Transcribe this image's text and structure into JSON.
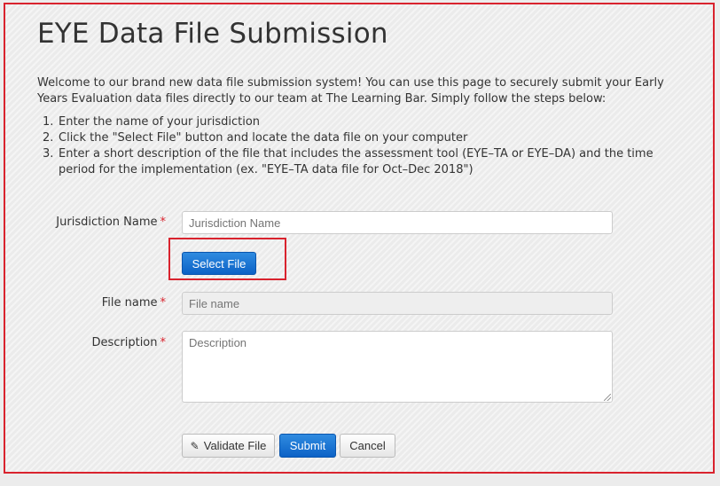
{
  "page": {
    "title": "EYE Data File Submission",
    "intro": "Welcome to our brand new data file submission system! You can use this page to securely submit your Early Years Evaluation data files directly to our team at The Learning Bar. Simply follow the steps below:",
    "steps": [
      {
        "num": "1.",
        "text": "Enter the name of your jurisdiction"
      },
      {
        "num": "2.",
        "text": "Click the \"Select File\" button and locate the data file on your computer"
      },
      {
        "num": "3.",
        "text": "Enter a short description of the file that includes the assessment tool (EYE–TA or EYE–DA) and the time period for the implementation (ex. \"EYE–TA data file for Oct–Dec 2018\")"
      }
    ]
  },
  "form": {
    "required_marker": "*",
    "jurisdiction": {
      "label": "Jurisdiction Name",
      "placeholder": "Jurisdiction Name",
      "value": ""
    },
    "select_file": {
      "label": "Select File"
    },
    "file_name": {
      "label": "File name",
      "placeholder": "File name",
      "value": "",
      "disabled": true
    },
    "description": {
      "label": "Description",
      "placeholder": "Description",
      "value": ""
    }
  },
  "actions": {
    "validate_icon": "pencil-icon",
    "validate": "Validate File",
    "submit": "Submit",
    "cancel": "Cancel"
  },
  "colors": {
    "highlight": "#d9232e",
    "primary": "#0c62c6",
    "required": "#d9232e"
  }
}
